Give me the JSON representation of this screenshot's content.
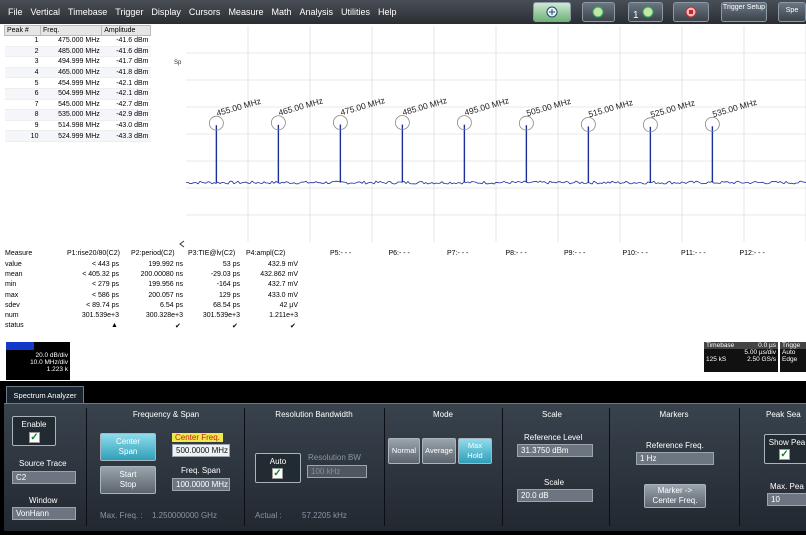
{
  "menu": [
    "File",
    "Vertical",
    "Timebase",
    "Trigger",
    "Display",
    "Cursors",
    "Measure",
    "Math",
    "Analysis",
    "Utilities",
    "Help"
  ],
  "toolbar": {
    "trigger_setup": "Trigger Setup",
    "spec_label": "Spe"
  },
  "peak_table": {
    "headers": [
      "Peak #",
      "Freq.",
      "Amplitude"
    ],
    "rows": [
      [
        "1",
        "475.000 MHz",
        "-41.6 dBm"
      ],
      [
        "2",
        "485.000 MHz",
        "-41.6 dBm"
      ],
      [
        "3",
        "494.999 MHz",
        "-41.7 dBm"
      ],
      [
        "4",
        "465.000 MHz",
        "-41.8 dBm"
      ],
      [
        "5",
        "454.999 MHz",
        "-42.1 dBm"
      ],
      [
        "6",
        "504.999 MHz",
        "-42.1 dBm"
      ],
      [
        "7",
        "545.000 MHz",
        "-42.7 dBm"
      ],
      [
        "8",
        "535.000 MHz",
        "-42.9 dBm"
      ],
      [
        "9",
        "514.998 MHz",
        "-43.0 dBm"
      ],
      [
        "10",
        "524.999 MHz",
        "-43.3 dBm"
      ]
    ]
  },
  "plot": {
    "marker_label": "Sp",
    "peak_labels": [
      "455.00 MHz",
      "465.00 MHz",
      "475.00 MHz",
      "485.00 MHz",
      "495.00 MHz",
      "505.00 MHz",
      "515.00 MHz",
      "525.00 MHz",
      "535.00 MHz"
    ]
  },
  "measure": {
    "header": "Measure",
    "row_labels": [
      "value",
      "mean",
      "min",
      "max",
      "sdev",
      "num",
      "status"
    ],
    "params": [
      {
        "name": "P1:rise20/80(C2)",
        "values": [
          "< 443 ps",
          "< 405.32 ps",
          "< 279 ps",
          "< 586 ps",
          "< 89.74 ps",
          "301.539e+3"
        ],
        "status": "warn"
      },
      {
        "name": "P2:period(C2)",
        "values": [
          "199.992 ns",
          "200.00080 ns",
          "199.956 ns",
          "200.057 ns",
          "6.54 ps",
          "300.328e+3"
        ],
        "status": "ok"
      },
      {
        "name": "P3:TIE@lv(C2)",
        "values": [
          "53 ps",
          "-29.03 ps",
          "-164 ps",
          "129 ps",
          "68.54 ps",
          "301.539e+3"
        ],
        "status": "ok"
      },
      {
        "name": "P4:ampl(C2)",
        "values": [
          "432.9 mV",
          "432.862 mV",
          "432.7 mV",
          "433.0 mV",
          "42 µV",
          "1.211e+3"
        ],
        "status": "ok"
      }
    ],
    "empty_params": [
      "P5:- - -",
      "P6:- - -",
      "P7:- - -",
      "P8:- - -",
      "P9:- - -",
      "P10:- - -",
      "P11:- - -",
      "P12:- - -"
    ]
  },
  "trace_desc": {
    "line1": "20.0 dB/div",
    "line2": "10.0 MHz/div",
    "line3": "1.223 k"
  },
  "timebase": {
    "title": "Timebase",
    "delay": "0.0 µs",
    "per_div": "5.00 µs/div",
    "samples": "125 kS",
    "rate": "2.50 GS/s"
  },
  "trigger": {
    "title": "Trigge",
    "mode": "Auto",
    "type": "Edge"
  },
  "panel": {
    "tab": "Spectrum Analyzer",
    "enable": "Enable",
    "source_trace_label": "Source Trace",
    "source_trace": "C2",
    "window_label": "Window",
    "window": "VonHann",
    "freq_span_title": "Frequency & Span",
    "center_span": "Center Span",
    "start_stop": "Start Stop",
    "center_freq_label": "Center Freq.",
    "center_freq": "500.0000 MHz",
    "freq_span_label": "Freq. Span",
    "freq_span": "100.0000 MHz",
    "max_freq_label": "Max. Freq. :",
    "max_freq": "1.250000000 GHz",
    "rbw_title": "Resolution Bandwidth",
    "auto": "Auto",
    "resolution_bw_label": "Resolution BW",
    "resolution_bw": "100 kHz",
    "actual_label": "Actual :",
    "actual": "57.2205 kHz",
    "mode_title": "Mode",
    "mode_normal": "Normal",
    "mode_average": "Average",
    "mode_max_hold": "Max Hold",
    "scale_title": "Scale",
    "ref_level_label": "Reference Level",
    "ref_level": "31.3750 dBm",
    "scale_label": "Scale",
    "scale": "20.0 dB",
    "markers_title": "Markers",
    "ref_freq_label": "Reference Freq.",
    "ref_freq": "1 Hz",
    "marker_center": "Marker -> Center Freq.",
    "peak_search_title": "Peak Sea",
    "show_peaks": "Show Pea",
    "max_peaks_label": "Max. Pea",
    "max_peaks": "10"
  },
  "chart_data": {
    "type": "line",
    "xlabel": "",
    "ylabel": "",
    "x": [
      455.0,
      465.0,
      475.0,
      485.0,
      495.0,
      505.0,
      515.0,
      525.0,
      535.0
    ],
    "series": [
      {
        "values": [
          -42.1,
          -41.8,
          -41.6,
          -41.6,
          -41.7,
          -42.1,
          -43.0,
          -43.3,
          -42.9
        ]
      }
    ]
  }
}
